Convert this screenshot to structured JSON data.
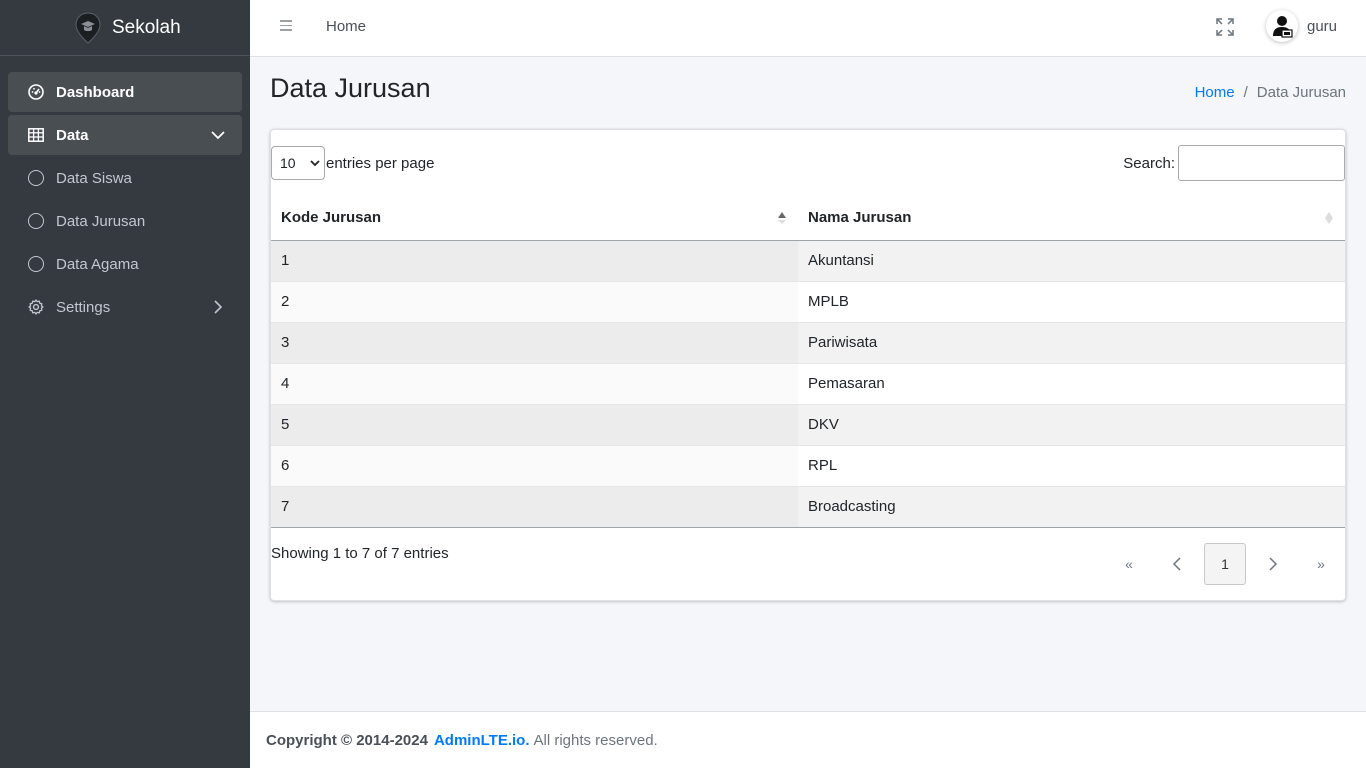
{
  "brand": {
    "name": "Sekolah",
    "logo_icon": "graduation-pin-icon"
  },
  "sidebar": {
    "items": [
      {
        "label": "Dashboard",
        "icon": "tachometer-icon"
      },
      {
        "label": "Data",
        "icon": "table-icon"
      },
      {
        "label": "Data Siswa",
        "icon": "circle-icon"
      },
      {
        "label": "Data Jurusan",
        "icon": "circle-icon"
      },
      {
        "label": "Data Agama",
        "icon": "circle-icon"
      },
      {
        "label": "Settings",
        "icon": "gear-icon"
      }
    ]
  },
  "header": {
    "home_label": "Home",
    "user_name": "guru"
  },
  "page": {
    "title": "Data Jurusan",
    "breadcrumb": {
      "home": "Home",
      "sep": "/",
      "current": "Data Jurusan"
    }
  },
  "table_controls": {
    "length_value": "10",
    "length_label": "entries per page",
    "search_label": "Search:",
    "search_value": ""
  },
  "table": {
    "columns": [
      "Kode Jurusan",
      "Nama Jurusan"
    ],
    "rows": [
      [
        "1",
        "Akuntansi"
      ],
      [
        "2",
        "MPLB"
      ],
      [
        "3",
        "Pariwisata"
      ],
      [
        "4",
        "Pemasaran"
      ],
      [
        "5",
        "DKV"
      ],
      [
        "6",
        "RPL"
      ],
      [
        "7",
        "Broadcasting"
      ]
    ]
  },
  "pagination": {
    "info": "Showing 1 to 7 of 7 entries",
    "first": "«",
    "prev": "‹",
    "current": "1",
    "next": "›",
    "last": "»"
  },
  "footer": {
    "copyright": "Copyright © 2014-2024",
    "link": "AdminLTE.io.",
    "rest": "All rights reserved."
  },
  "colors": {
    "sidebar_bg": "#343a40",
    "link": "#007bff",
    "content_bg": "#f4f6f9"
  }
}
